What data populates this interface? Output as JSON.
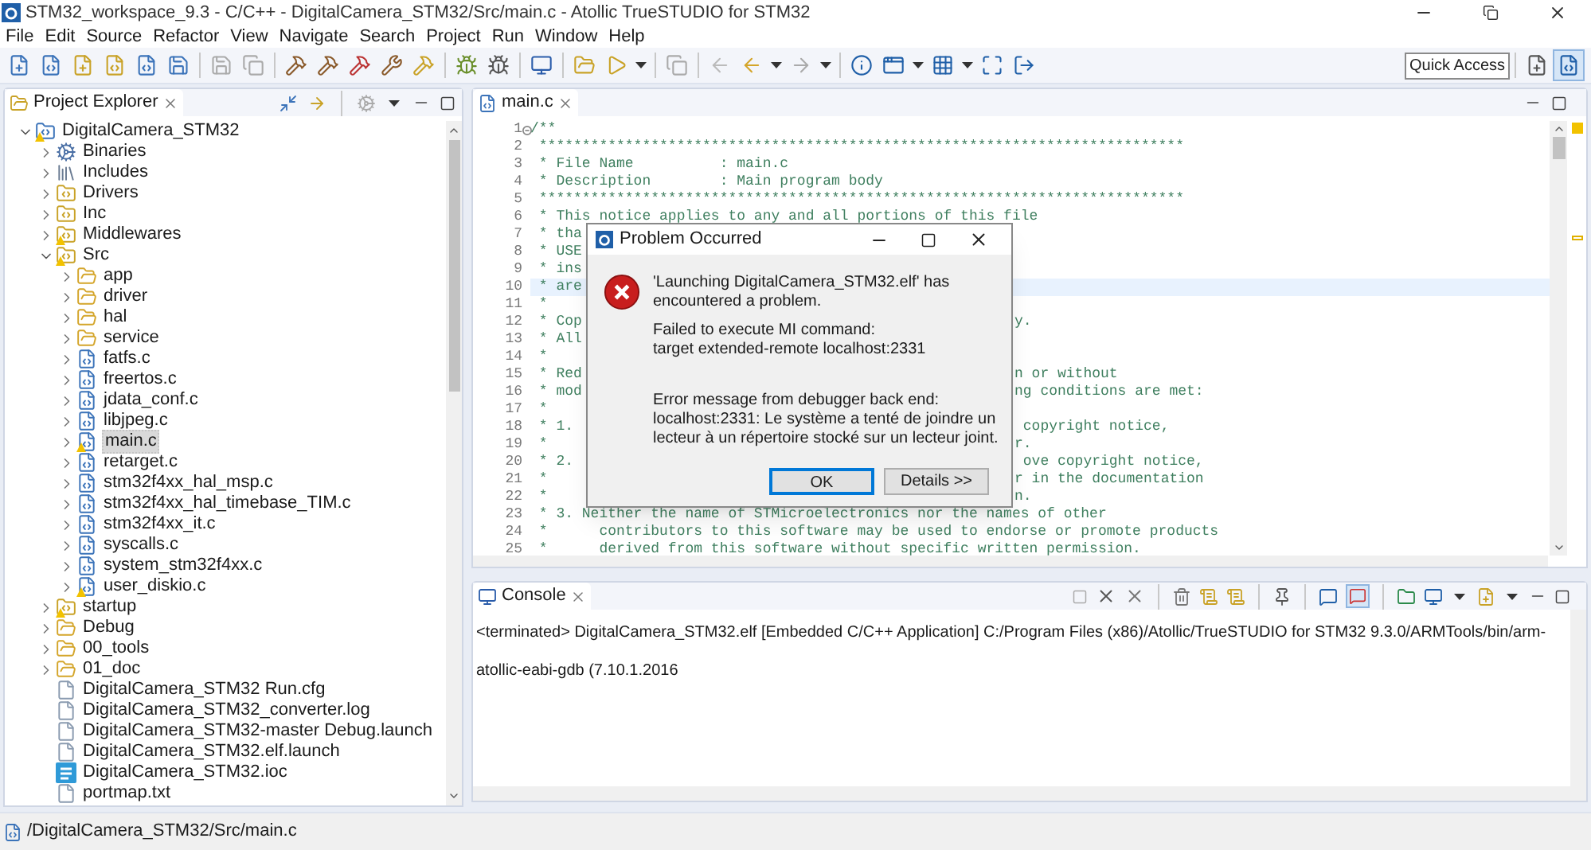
{
  "window": {
    "title": "STM32_workspace_9.3 - C/C++ - DigitalCamera_STM32/Src/main.c - Atollic TrueSTUDIO for STM32"
  },
  "menu": [
    "File",
    "Edit",
    "Source",
    "Refactor",
    "View",
    "Navigate",
    "Search",
    "Project",
    "Run",
    "Window",
    "Help"
  ],
  "quick_access": {
    "placeholder": "Quick Access"
  },
  "project_explorer": {
    "title": "Project Explorer",
    "tree": [
      {
        "label": "DigitalCamera_STM32",
        "kind": "project",
        "expanded": true,
        "warning": true,
        "selected": false,
        "children": [
          {
            "label": "Binaries",
            "kind": "binaries",
            "expanded": false,
            "selected": false
          },
          {
            "label": "Includes",
            "kind": "includes",
            "expanded": false,
            "selected": false
          },
          {
            "label": "Drivers",
            "kind": "source-folder",
            "expanded": false,
            "selected": false
          },
          {
            "label": "Inc",
            "kind": "source-folder",
            "expanded": false,
            "selected": false
          },
          {
            "label": "Middlewares",
            "kind": "source-folder",
            "expanded": false,
            "warning": true,
            "selected": false
          },
          {
            "label": "Src",
            "kind": "source-folder",
            "expanded": true,
            "warning": true,
            "selected": false,
            "children": [
              {
                "label": "app",
                "kind": "folder",
                "expanded": false,
                "selected": false
              },
              {
                "label": "driver",
                "kind": "folder",
                "expanded": false,
                "selected": false
              },
              {
                "label": "hal",
                "kind": "folder",
                "expanded": false,
                "selected": false
              },
              {
                "label": "service",
                "kind": "folder",
                "expanded": false,
                "selected": false
              },
              {
                "label": "fatfs.c",
                "kind": "c-file",
                "expanded": false,
                "selected": false
              },
              {
                "label": "freertos.c",
                "kind": "c-file",
                "expanded": false,
                "selected": false
              },
              {
                "label": "jdata_conf.c",
                "kind": "c-file",
                "expanded": false,
                "selected": false
              },
              {
                "label": "libjpeg.c",
                "kind": "c-file",
                "expanded": false,
                "selected": false
              },
              {
                "label": "main.c",
                "kind": "c-file",
                "expanded": false,
                "warning": true,
                "selected": true
              },
              {
                "label": "retarget.c",
                "kind": "c-file",
                "expanded": false,
                "selected": false
              },
              {
                "label": "stm32f4xx_hal_msp.c",
                "kind": "c-file",
                "expanded": false,
                "selected": false
              },
              {
                "label": "stm32f4xx_hal_timebase_TIM.c",
                "kind": "c-file",
                "expanded": false,
                "selected": false
              },
              {
                "label": "stm32f4xx_it.c",
                "kind": "c-file",
                "expanded": false,
                "selected": false
              },
              {
                "label": "syscalls.c",
                "kind": "c-file",
                "expanded": false,
                "selected": false
              },
              {
                "label": "system_stm32f4xx.c",
                "kind": "c-file",
                "expanded": false,
                "selected": false
              },
              {
                "label": "user_diskio.c",
                "kind": "c-file",
                "expanded": false,
                "warning": true,
                "selected": false
              }
            ]
          },
          {
            "label": "startup",
            "kind": "source-folder",
            "expanded": false,
            "warning": true,
            "selected": false
          },
          {
            "label": "Debug",
            "kind": "folder",
            "expanded": false,
            "selected": false
          },
          {
            "label": "00_tools",
            "kind": "folder",
            "expanded": false,
            "selected": false
          },
          {
            "label": "01_doc",
            "kind": "folder",
            "expanded": false,
            "selected": false
          },
          {
            "label": "DigitalCamera_STM32 Run.cfg",
            "kind": "file",
            "selected": false
          },
          {
            "label": "DigitalCamera_STM32_converter.log",
            "kind": "file",
            "selected": false
          },
          {
            "label": "DigitalCamera_STM32-master Debug.launch",
            "kind": "file",
            "selected": false
          },
          {
            "label": "DigitalCamera_STM32.elf.launch",
            "kind": "file",
            "selected": false
          },
          {
            "label": "DigitalCamera_STM32.ioc",
            "kind": "mx",
            "selected": false
          },
          {
            "label": "portmap.txt",
            "kind": "file",
            "selected": false
          }
        ]
      }
    ]
  },
  "editor": {
    "tab": {
      "label": "main.c",
      "selected": true
    },
    "lines": [
      {
        "number": "1",
        "left": "/**",
        "fold_marker": true,
        "current": false
      },
      {
        "number": "2",
        "left": " ***************************************************************************",
        "current": false
      },
      {
        "number": "3",
        "left": " * File Name          : main.c",
        "current": false
      },
      {
        "number": "4",
        "left": " * Description        : Main program body",
        "current": false
      },
      {
        "number": "5",
        "left": " ***************************************************************************",
        "current": false
      },
      {
        "number": "6",
        "left": " * This notice applies to any and all portions of this file",
        "current": false
      },
      {
        "number": "7",
        "left": " * tha",
        "current": false
      },
      {
        "number": "8",
        "left": " * USE",
        "current": false
      },
      {
        "number": "9",
        "left": " * ins",
        "current": false
      },
      {
        "number": "10",
        "left": " * are",
        "current": true
      },
      {
        "number": "11",
        "left": " *",
        "current": false
      },
      {
        "number": "12",
        "left": " * Cop",
        "right": "y.",
        "current": false
      },
      {
        "number": "13",
        "left": " * All",
        "current": false
      },
      {
        "number": "14",
        "left": " *",
        "current": false
      },
      {
        "number": "15",
        "left": " * Red",
        "right": "n or without",
        "current": false
      },
      {
        "number": "16",
        "left": " * mod",
        "right": "ng conditions are met:",
        "current": false
      },
      {
        "number": "17",
        "left": " *",
        "current": false
      },
      {
        "number": "18",
        "left": " * 1.",
        "right": " copyright notice,",
        "current": false
      },
      {
        "number": "19",
        "left": " *",
        "right": "r.",
        "current": false
      },
      {
        "number": "20",
        "left": " * 2.",
        "right": " ove copyright notice,",
        "current": false
      },
      {
        "number": "21",
        "left": " *",
        "right": "r in the documentation",
        "current": false
      },
      {
        "number": "22",
        "left": " *",
        "right": "n.",
        "current": false
      },
      {
        "number": "23",
        "left": " * 3. Neither the name of STMicroelectronics nor the names of other",
        "current": false
      },
      {
        "number": "24",
        "left": " *      contributors to this software may be used to endorse or promote products",
        "current": false
      },
      {
        "number": "25",
        "left": " *      derived from this software without specific written permission.",
        "current": false
      }
    ]
  },
  "dialog": {
    "title": "Problem Occurred",
    "message": "'Launching DigitalCamera_STM32.elf' has encountered a problem.",
    "details": [
      "Failed to execute MI command:",
      "target extended-remote localhost:2331"
    ],
    "error": [
      "Error message from debugger back end:",
      "localhost:2331: Le système a tenté de joindre un lecteur à un répertoire stocké sur un lecteur joint."
    ],
    "buttons": [
      {
        "label": "OK",
        "selected": true
      },
      {
        "label": "Details >>",
        "selected": false
      }
    ]
  },
  "console": {
    "title": "Console",
    "text": "<terminated> DigitalCamera_STM32.elf [Embedded C/C++ Application] C:/Program Files (x86)/Atollic/TrueSTUDIO for STM32 9.3.0/ARMTools/bin/arm-atollic-eabi-gdb (7.10.1.2016"
  },
  "status_bar": {
    "path": "/DigitalCamera_STM32/Src/main.c"
  }
}
